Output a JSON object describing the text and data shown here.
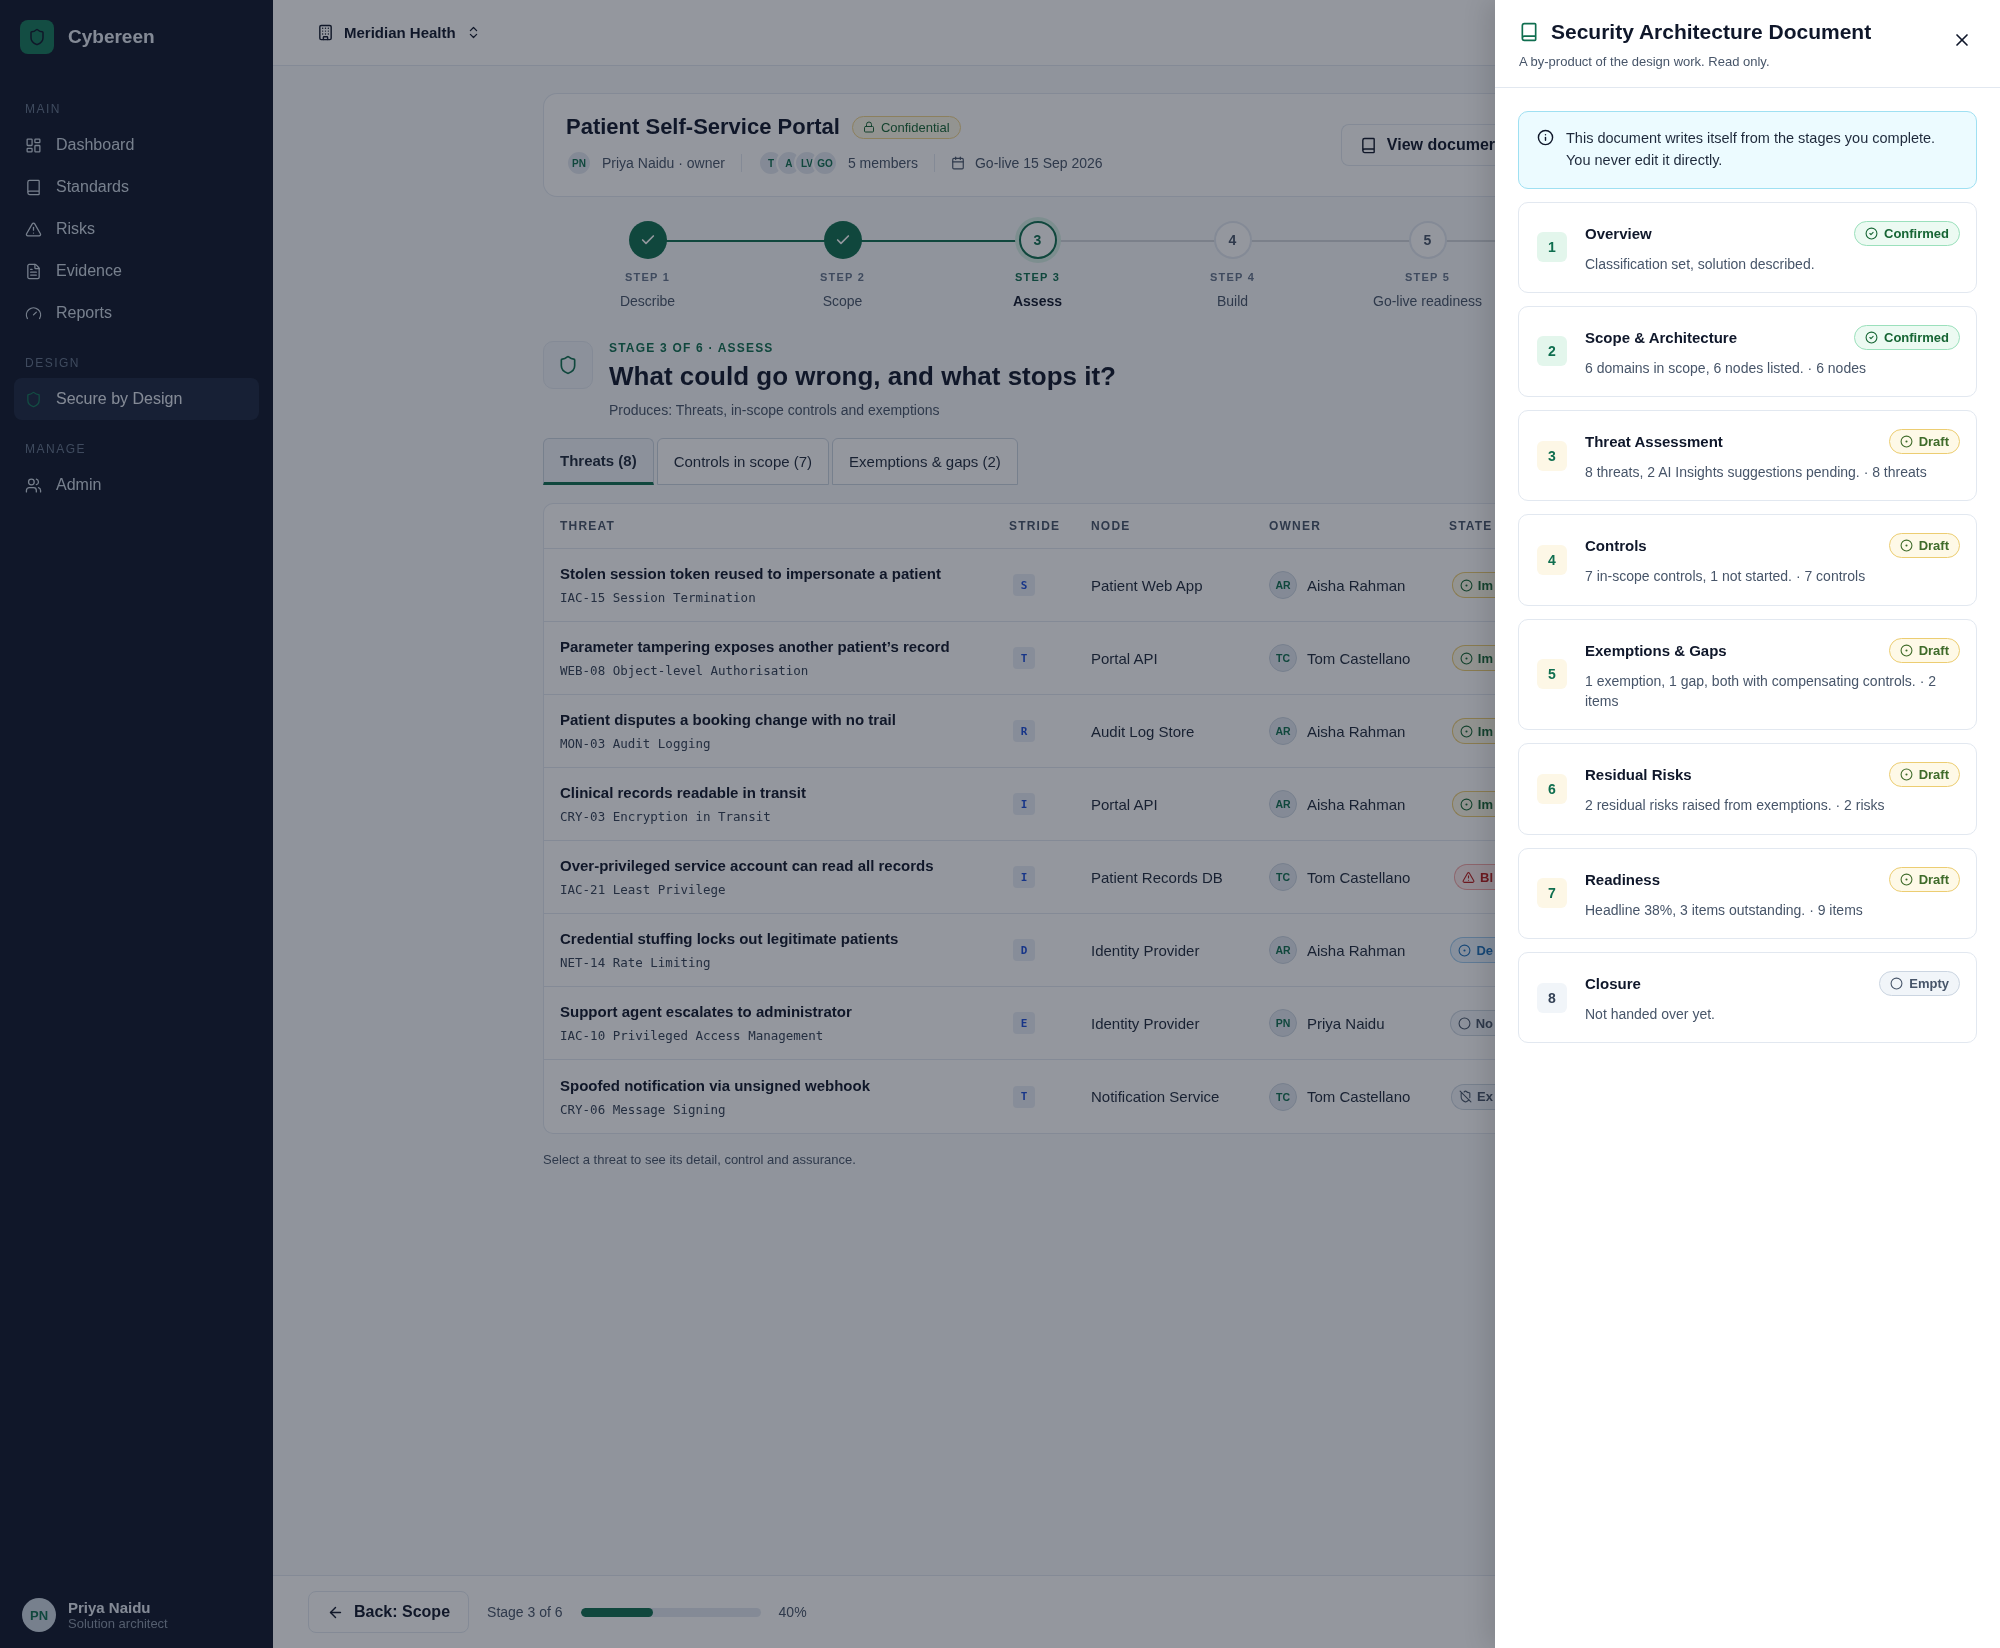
{
  "sidebar": {
    "brand": "Cybereen",
    "sections": [
      {
        "heading": "MAIN",
        "items": [
          {
            "label": "Dashboard",
            "kind": "dashboard",
            "selected": false
          },
          {
            "label": "Standards",
            "kind": "standards",
            "selected": false
          },
          {
            "label": "Risks",
            "kind": "risks",
            "selected": false
          },
          {
            "label": "Evidence",
            "kind": "evidence",
            "selected": false
          },
          {
            "label": "Reports",
            "kind": "reports",
            "selected": false
          }
        ]
      },
      {
        "heading": "DESIGN",
        "items": [
          {
            "label": "Secure by Design",
            "kind": "design",
            "selected": true
          }
        ]
      },
      {
        "heading": "MANAGE",
        "items": [
          {
            "label": "Admin",
            "kind": "admin",
            "selected": false
          }
        ]
      }
    ],
    "user": {
      "initials": "PN",
      "name": "Priya Naidu",
      "role": "Solution architect"
    }
  },
  "topbar": {
    "organisation": "Meridian Health"
  },
  "project": {
    "title": "Patient Self-Service Portal",
    "classification": "Confidential",
    "owner_initials": "PN",
    "owner": "Priya Naidu · owner",
    "member_avatars": [
      "T",
      "A",
      "LV",
      "GO"
    ],
    "members": "5 members",
    "go_live": "Go-live 15 Sep 2026",
    "document_button": "View documer"
  },
  "steps": [
    {
      "step": "STEP 1",
      "label": "Describe",
      "kind": "done"
    },
    {
      "step": "STEP 2",
      "label": "Scope",
      "kind": "done"
    },
    {
      "step": "STEP 3",
      "label": "Assess",
      "kind": "current",
      "number": "3"
    },
    {
      "step": "STEP 4",
      "label": "Build",
      "kind": "upcoming",
      "number": "4"
    },
    {
      "step": "STEP 5",
      "label": "Go-live readiness",
      "kind": "upcoming",
      "number": "5"
    }
  ],
  "stage": {
    "eyebrow": "STAGE 3 OF 6 · ASSESS",
    "title": "What could go wrong, and what stops it?",
    "produces": "Produces: Threats, in-scope controls and exemptions"
  },
  "tabs": [
    {
      "label": "Threats (8)",
      "selected": true
    },
    {
      "label": "Controls in scope (7)",
      "selected": false
    },
    {
      "label": "Exemptions & gaps (2)",
      "selected": false
    }
  ],
  "table": {
    "columns": [
      "THREAT",
      "STRIDE",
      "NODE",
      "OWNER",
      "STATE"
    ],
    "rows": [
      {
        "threat": "Stolen session token reused to impersonate a patient",
        "control": "IAC-15 Session Termination",
        "stride": "S",
        "node": "Patient Web App",
        "owner_initials": "AR",
        "owner": "Aisha Rahman",
        "state": {
          "label": "Im",
          "kind": "progress"
        }
      },
      {
        "threat": "Parameter tampering exposes another patient’s record",
        "control": "WEB-08 Object-level Authorisation",
        "stride": "T",
        "node": "Portal API",
        "owner_initials": "TC",
        "owner": "Tom Castellano",
        "state": {
          "label": "Im",
          "kind": "progress"
        }
      },
      {
        "threat": "Patient disputes a booking change with no trail",
        "control": "MON-03 Audit Logging",
        "stride": "R",
        "node": "Audit Log Store",
        "owner_initials": "AR",
        "owner": "Aisha Rahman",
        "state": {
          "label": "Im",
          "kind": "progress"
        }
      },
      {
        "threat": "Clinical records readable in transit",
        "control": "CRY-03 Encryption in Transit",
        "stride": "I",
        "node": "Portal API",
        "owner_initials": "AR",
        "owner": "Aisha Rahman",
        "state": {
          "label": "Im",
          "kind": "progress"
        }
      },
      {
        "threat": "Over-privileged service account can read all records",
        "control": "IAC-21 Least Privilege",
        "stride": "I",
        "node": "Patient Records DB",
        "owner_initials": "TC",
        "owner": "Tom Castellano",
        "state": {
          "label": "Bl",
          "kind": "blocked"
        }
      },
      {
        "threat": "Credential stuffing locks out legitimate patients",
        "control": "NET-14 Rate Limiting",
        "stride": "D",
        "node": "Identity Provider",
        "owner_initials": "AR",
        "owner": "Aisha Rahman",
        "state": {
          "label": "De",
          "kind": "deferred"
        }
      },
      {
        "threat": "Support agent escalates to administrator",
        "control": "IAC-10 Privileged Access Management",
        "stride": "E",
        "node": "Identity Provider",
        "owner_initials": "PN",
        "owner": "Priya Naidu",
        "state": {
          "label": "No",
          "kind": "not_started"
        }
      },
      {
        "threat": "Spoofed notification via unsigned webhook",
        "control": "CRY-06 Message Signing",
        "stride": "T",
        "node": "Notification Service",
        "owner_initials": "TC",
        "owner": "Tom Castellano",
        "state": {
          "label": "Ex",
          "kind": "exempt"
        }
      }
    ]
  },
  "hint": "Select a threat to see its detail, control and assurance.",
  "footer": {
    "back": "Back: Scope",
    "stage": "Stage 3 of 6",
    "level": 0.4,
    "percent": "40%"
  },
  "drawer": {
    "title": "Security Architecture Document",
    "subtitle": "A by-product of the design work. Read only.",
    "notice": "This document writes itself from the stages you complete. You never edit it directly.",
    "sections": [
      {
        "number": "1",
        "title": "Overview",
        "summary": "Classification set, solution described.",
        "status": {
          "label": "Confirmed",
          "kind": "confirmed"
        }
      },
      {
        "number": "2",
        "title": "Scope & Architecture",
        "summary": "6 domains in scope, 6 nodes listed. · 6 nodes",
        "status": {
          "label": "Confirmed",
          "kind": "confirmed"
        }
      },
      {
        "number": "3",
        "title": "Threat Assessment",
        "summary": "8 threats, 2 AI Insights suggestions pending. · 8 threats",
        "status": {
          "label": "Draft",
          "kind": "draft"
        }
      },
      {
        "number": "4",
        "title": "Controls",
        "summary": "7 in-scope controls, 1 not started. · 7 controls",
        "status": {
          "label": "Draft",
          "kind": "draft"
        }
      },
      {
        "number": "5",
        "title": "Exemptions & Gaps",
        "summary": "1 exemption, 1 gap, both with compensating controls. · 2 items",
        "status": {
          "label": "Draft",
          "kind": "draft"
        }
      },
      {
        "number": "6",
        "title": "Residual Risks",
        "summary": "2 residual risks raised from exemptions. · 2 risks",
        "status": {
          "label": "Draft",
          "kind": "draft"
        }
      },
      {
        "number": "7",
        "title": "Readiness",
        "summary": "Headline 38%, 3 items outstanding. · 9 items",
        "status": {
          "label": "Draft",
          "kind": "draft"
        }
      },
      {
        "number": "8",
        "title": "Closure",
        "summary": "Not handed over yet.",
        "status": {
          "label": "Empty",
          "kind": "empty"
        }
      }
    ]
  }
}
